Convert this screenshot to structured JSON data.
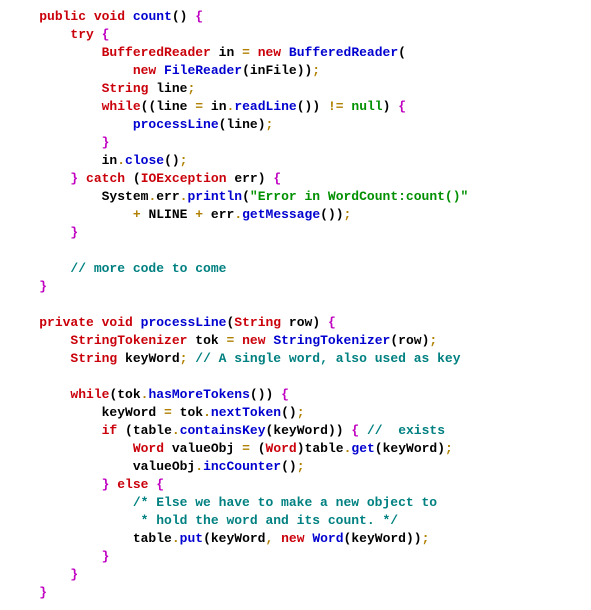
{
  "code": {
    "l1": {
      "indent": "    ",
      "kw1": "public void",
      "sp": " ",
      "name": "count",
      "paren": "()",
      "sp2": " ",
      "brace": "{"
    },
    "l2": {
      "indent": "        ",
      "kw": "try",
      "sp": " ",
      "brace": "{"
    },
    "l3": {
      "indent": "            ",
      "type": "BufferedReader",
      "sp": " ",
      "id": "in",
      "sp2": " ",
      "op": "=",
      "sp3": " ",
      "kw": "new",
      "sp4": " ",
      "ctor": "BufferedReader",
      "paren": "("
    },
    "l4": {
      "indent": "                ",
      "kw": "new",
      "sp": " ",
      "ctor": "FileReader",
      "p1": "(",
      "id": "inFile",
      "p2": "))",
      ";": ";"
    },
    "l5": {
      "indent": "            ",
      "type": "String",
      "sp": " ",
      "id": "line",
      ";": ";"
    },
    "l6": {
      "indent": "            ",
      "kw": "while",
      "p1": "((",
      "id1": "line",
      "sp1": " ",
      "op": "=",
      "sp2": " ",
      "id2": "in",
      "dot": ".",
      "m": "readLine",
      "p2": "())",
      "sp3": " ",
      "op2": "!=",
      "sp4": " ",
      "null": "null",
      "p3": ")",
      "sp5": " ",
      "brace": "{"
    },
    "l7": {
      "indent": "                ",
      "m": "processLine",
      "p1": "(",
      "id": "line",
      "p2": ")",
      ";": ";"
    },
    "l8": {
      "indent": "            ",
      "brace": "}"
    },
    "l9": {
      "indent": "            ",
      "id": "in",
      "dot": ".",
      "m": "close",
      "p": "()",
      ";": ";"
    },
    "l10": {
      "indent": "        ",
      "brace1": "}",
      "sp": " ",
      "kw": "catch",
      "sp2": " ",
      "p1": "(",
      "type": "IOException",
      "sp3": " ",
      "id": "err",
      "p2": ")",
      "sp4": " ",
      "brace2": "{"
    },
    "l11": {
      "indent": "            ",
      "id1": "System",
      "dot1": ".",
      "id2": "err",
      "dot2": ".",
      "m": "println",
      "p1": "(",
      "str": "\"Error in WordCount:count()\""
    },
    "l12": {
      "indent": "                ",
      "op": "+",
      "sp": " ",
      "id": "NLINE",
      "sp2": " ",
      "op2": "+",
      "sp3": " ",
      "id2": "err",
      "dot": ".",
      "m": "getMessage",
      "p": "())",
      ";": ";"
    },
    "l13": {
      "indent": "        ",
      "brace": "}"
    },
    "l15": {
      "indent": "        ",
      "cmt": "// more code to come"
    },
    "l16": {
      "indent": "    ",
      "brace": "}"
    },
    "l18": {
      "indent": "    ",
      "kw": "private void",
      "sp": " ",
      "name": "processLine",
      "p1": "(",
      "type": "String",
      "sp2": " ",
      "id": "row",
      "p2": ")",
      "sp3": " ",
      "brace": "{"
    },
    "l19": {
      "indent": "        ",
      "type": "StringTokenizer",
      "sp": " ",
      "id": "tok",
      "sp2": " ",
      "op": "=",
      "sp3": " ",
      "kw": "new",
      "sp4": " ",
      "ctor": "StringTokenizer",
      "p1": "(",
      "id2": "row",
      "p2": ")",
      ";": ";"
    },
    "l20": {
      "indent": "        ",
      "type": "String",
      "sp": " ",
      "id": "keyWord",
      ";": ";",
      "sp2": " ",
      "cmt": "// A single word, also used as key"
    },
    "l22": {
      "indent": "        ",
      "kw": "while",
      "p1": "(",
      "id": "tok",
      "dot": ".",
      "m": "hasMoreTokens",
      "p2": "())",
      "sp": " ",
      "brace": "{"
    },
    "l23": {
      "indent": "            ",
      "id": "keyWord",
      "sp": " ",
      "op": "=",
      "sp2": " ",
      "id2": "tok",
      "dot": ".",
      "m": "nextToken",
      "p": "()",
      ";": ";"
    },
    "l24": {
      "indent": "            ",
      "kw": "if",
      "sp": " ",
      "p1": "(",
      "id": "table",
      "dot": ".",
      "m": "containsKey",
      "p2": "(",
      "id2": "keyWord",
      "p3": "))",
      "sp2": " ",
      "brace": "{",
      "sp3": " ",
      "cmt": "//  exists"
    },
    "l25": {
      "indent": "                ",
      "type": "Word",
      "sp": " ",
      "id": "valueObj",
      "sp2": " ",
      "op": "=",
      "sp3": " ",
      "p1": "(",
      "type2": "Word",
      "p2": ")",
      "id2": "table",
      "dot": ".",
      "m": "get",
      "p3": "(",
      "id3": "keyWord",
      "p4": ")",
      ";": ";"
    },
    "l26": {
      "indent": "                ",
      "id": "valueObj",
      "dot": ".",
      "m": "incCounter",
      "p": "()",
      ";": ";"
    },
    "l27": {
      "indent": "            ",
      "brace1": "}",
      "sp": " ",
      "kw": "else",
      "sp2": " ",
      "brace2": "{"
    },
    "l28": {
      "indent": "                ",
      "cmt": "/* Else we have to make a new object to"
    },
    "l29": {
      "indent": "                 ",
      "cmt": "* hold the word and its count. */"
    },
    "l30": {
      "indent": "                ",
      "id": "table",
      "dot": ".",
      "m": "put",
      "p1": "(",
      "id2": "keyWord",
      "c": ",",
      "sp": " ",
      "kw": "new",
      "sp2": " ",
      "ctor": "Word",
      "p2": "(",
      "id3": "keyWord",
      "p3": "))",
      ";": ";"
    },
    "l31": {
      "indent": "            ",
      "brace": "}"
    },
    "l32": {
      "indent": "        ",
      "brace": "}"
    },
    "l33": {
      "indent": "    ",
      "brace": "}"
    }
  }
}
